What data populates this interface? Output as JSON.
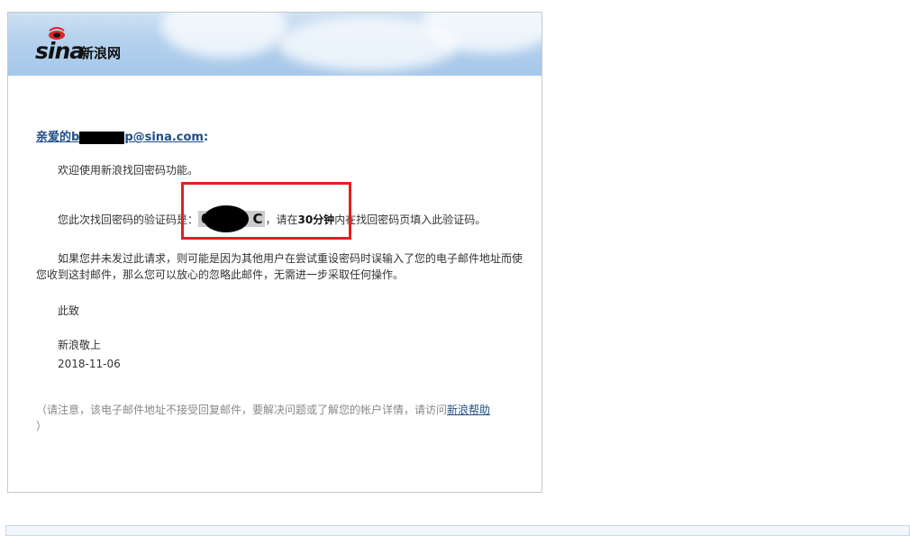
{
  "brand": {
    "logo_word": "sina",
    "logo_cn": "新浪网"
  },
  "email": {
    "greeting_prefix": "亲爱的b",
    "greeting_suffix": "p@sina.com",
    "greeting_colon": ":",
    "welcome": "欢迎使用新浪找回密码功能。",
    "code_prefix": "您此次找回密码的验证码是：",
    "code_visible_start": "0",
    "code_visible_end": "C",
    "code_suffix_1": "，请在",
    "code_time": "30分钟",
    "code_suffix_2": "内在找回密码页填入此验证码。",
    "ignore_text": "如果您并未发过此请求，则可能是因为其他用户在尝试重设密码时误输入了您的电子邮件地址而使您收到这封邮件，那么您可以放心的忽略此邮件，无需进一步采取任何操作。",
    "closing": "此致",
    "signature": "新浪敬上",
    "date": "2018-11-06",
    "note_text": "（请注意，该电子邮件地址不接受回复邮件，要解决问题或了解您的帐户详情，请访问",
    "note_link": "新浪帮助",
    "note_end": "）"
  },
  "colors": {
    "link": "#1f4e87",
    "highlight_box": "#e02020"
  }
}
